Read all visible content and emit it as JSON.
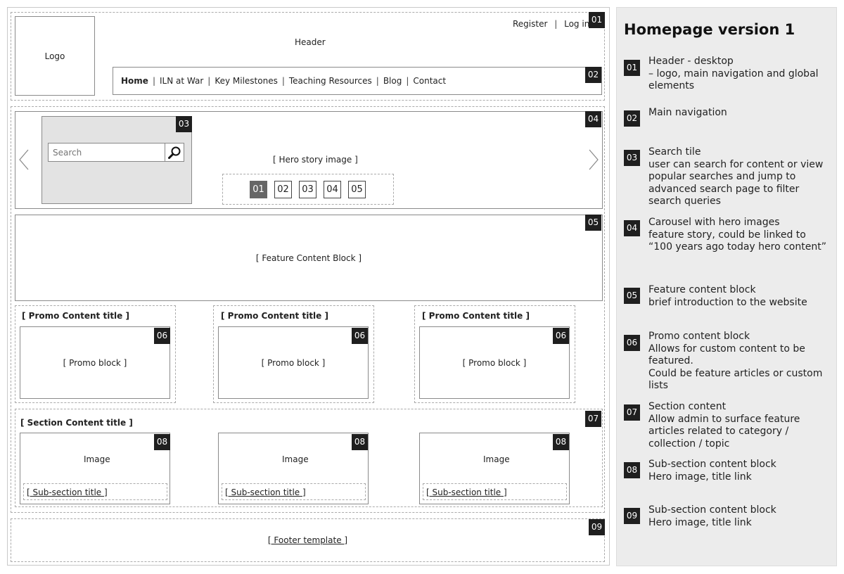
{
  "header": {
    "register": "Register",
    "separator": "|",
    "login": "Log in",
    "logo": "Logo",
    "label": "Header"
  },
  "nav": {
    "items": [
      "Home",
      "ILN at War",
      "Key Milestones",
      "Teaching Resources",
      "Blog",
      "Contact"
    ]
  },
  "search": {
    "placeholder": "Search"
  },
  "carousel": {
    "hero_label": "[ Hero story image ]",
    "pages": [
      "01",
      "02",
      "03",
      "04",
      "05"
    ],
    "active_page": "01"
  },
  "feature": {
    "label": "[ Feature Content Block ]"
  },
  "promos": [
    {
      "title": "[ Promo Content title ]",
      "block": "[ Promo block ]"
    },
    {
      "title": "[ Promo Content title ]",
      "block": "[ Promo block ]"
    },
    {
      "title": "[ Promo Content title ]",
      "block": "[ Promo block ]"
    }
  ],
  "section": {
    "title": "[ Section Content title ]",
    "subsections": [
      {
        "image": "Image",
        "title": "[ Sub-section title ]"
      },
      {
        "image": "Image",
        "title": "[ Sub-section title ]"
      },
      {
        "image": "Image",
        "title": "[ Sub-section title ]"
      }
    ]
  },
  "footer": {
    "label": "[ Footer template ]"
  },
  "badges": {
    "b01": "01",
    "b02": "02",
    "b03": "03",
    "b04": "04",
    "b05": "05",
    "b06": "06",
    "b07": "07",
    "b08": "08",
    "b09": "09"
  },
  "legend": {
    "title": "Homepage version 1",
    "items": [
      {
        "num": "01",
        "lines": [
          "Header - desktop",
          "– logo, main navigation and global elements"
        ]
      },
      {
        "num": "02",
        "lines": [
          "Main navigation"
        ]
      },
      {
        "num": "03",
        "lines": [
          "Search tile",
          "user can search for content or view popular searches and jump to advanced search page to filter search queries"
        ]
      },
      {
        "num": "04",
        "lines": [
          "Carousel with hero images",
          "feature story, could be linked to “100 years ago today hero content”"
        ]
      },
      {
        "num": "05",
        "lines": [
          "Feature content block",
          "brief introduction to the website"
        ]
      },
      {
        "num": "06",
        "lines": [
          "Promo content block",
          "Allows for custom content to be featured.",
          "Could be feature articles or custom lists"
        ]
      },
      {
        "num": "07",
        "lines": [
          "Section content",
          "Allow admin to surface feature articles related to category / collection / topic"
        ]
      },
      {
        "num": "08",
        "lines": [
          "Sub-section content block",
          "Hero image, title link"
        ]
      },
      {
        "num": "09",
        "lines": [
          "Sub-section content block",
          "Hero image, title link"
        ]
      }
    ]
  }
}
